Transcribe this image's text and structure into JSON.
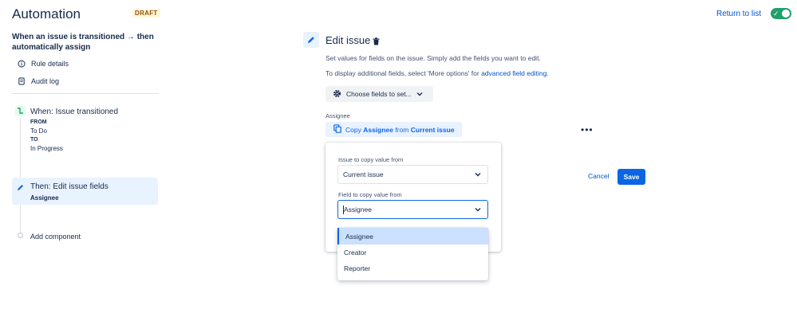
{
  "header": {
    "title": "Automation",
    "status_badge": "DRAFT",
    "return_link": "Return to list",
    "toggle_state": "on"
  },
  "sidebar": {
    "rule_name": "When an issue is transitioned → then automatically assign",
    "links": [
      {
        "label": "Rule details",
        "icon": "info-icon"
      },
      {
        "label": "Audit log",
        "icon": "document-icon"
      }
    ],
    "trigger": {
      "title": "When: Issue transitioned",
      "from_label": "FROM",
      "from_value": "To Do",
      "to_label": "TO",
      "to_value": "In Progress"
    },
    "action": {
      "title": "Then: Edit issue fields",
      "subtitle": "Assignee"
    },
    "add_component": "Add component"
  },
  "main": {
    "title": "Edit issue",
    "description1": "Set values for fields on the issue. Simply add the fields you want to edit.",
    "description2_prefix": "To display additional fields, select 'More options' for ",
    "description2_link": "advanced field editing",
    "description2_suffix": ".",
    "choose_fields_button": "Choose fields to set...",
    "field_label": "Assignee",
    "copy_button": {
      "prefix": "Copy ",
      "field": "Assignee",
      "middle": " from ",
      "source": "Current issue"
    },
    "more_button": "•••",
    "cancel_button": "Cancel",
    "save_button": "Save"
  },
  "popup": {
    "issue_label": "Issue to copy value from",
    "issue_value": "Current issue",
    "field_label": "Field to copy value from",
    "field_value": "Assignee",
    "options": [
      "Assignee",
      "Creator",
      "Reporter"
    ],
    "selected_option": "Assignee"
  },
  "colors": {
    "primary": "#0c66e4",
    "link": "#0052cc",
    "toggle_on": "#22a06b",
    "highlight": "#e9f2ff"
  }
}
